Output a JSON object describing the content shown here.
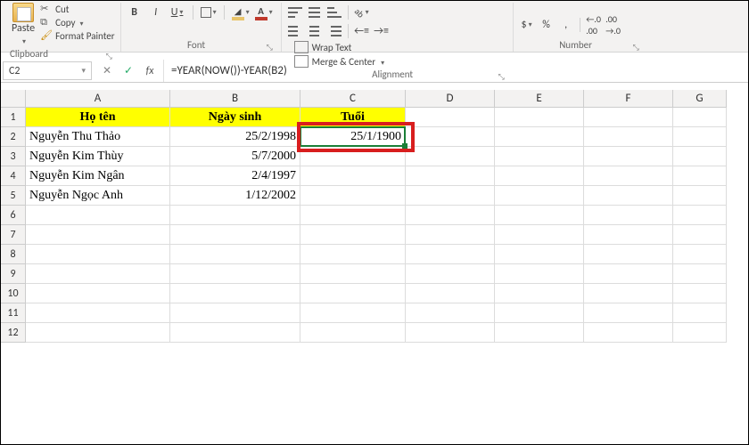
{
  "ribbon": {
    "clipboard": {
      "paste": "Paste",
      "cut": "Cut",
      "copy": "Copy",
      "format_painter": "Format Painter",
      "group_label": "Clipboard"
    },
    "font": {
      "bold": "B",
      "italic": "I",
      "underline": "U",
      "group_label": "Font"
    },
    "alignment": {
      "wrap_text": "Wrap Text",
      "merge_center": "Merge & Center",
      "group_label": "Alignment"
    },
    "number": {
      "currency": "$",
      "percent": "%",
      "comma": ",",
      "inc_dec": ".0",
      "dec_dec": ".00",
      "group_label": "Number"
    }
  },
  "formula_bar": {
    "name_box": "C2",
    "cancel": "✕",
    "enter": "✓",
    "fx": "fx",
    "formula": "=YEAR(NOW())-YEAR(B2)"
  },
  "columns": [
    "A",
    "B",
    "C",
    "D",
    "E",
    "F",
    "G"
  ],
  "col_widths": [
    "wA",
    "wB",
    "wC",
    "wD",
    "wE",
    "wF",
    "wG"
  ],
  "headers": {
    "A": "Họ tên",
    "B": "Ngày sinh",
    "C": "Tuổi"
  },
  "rows": [
    {
      "n": "2",
      "A": "Nguyễn Thu Thảo",
      "B": "25/2/1998",
      "C": "25/1/1900"
    },
    {
      "n": "3",
      "A": "Nguyễn Kim Thùy",
      "B": "5/7/2000",
      "C": ""
    },
    {
      "n": "4",
      "A": "Nguyễn Kim Ngân",
      "B": "2/4/1997",
      "C": ""
    },
    {
      "n": "5",
      "A": "Nguyễn Ngọc Anh",
      "B": "1/12/2002",
      "C": ""
    }
  ],
  "selected_cell": "C2",
  "highlight_color": "#d81e1e"
}
